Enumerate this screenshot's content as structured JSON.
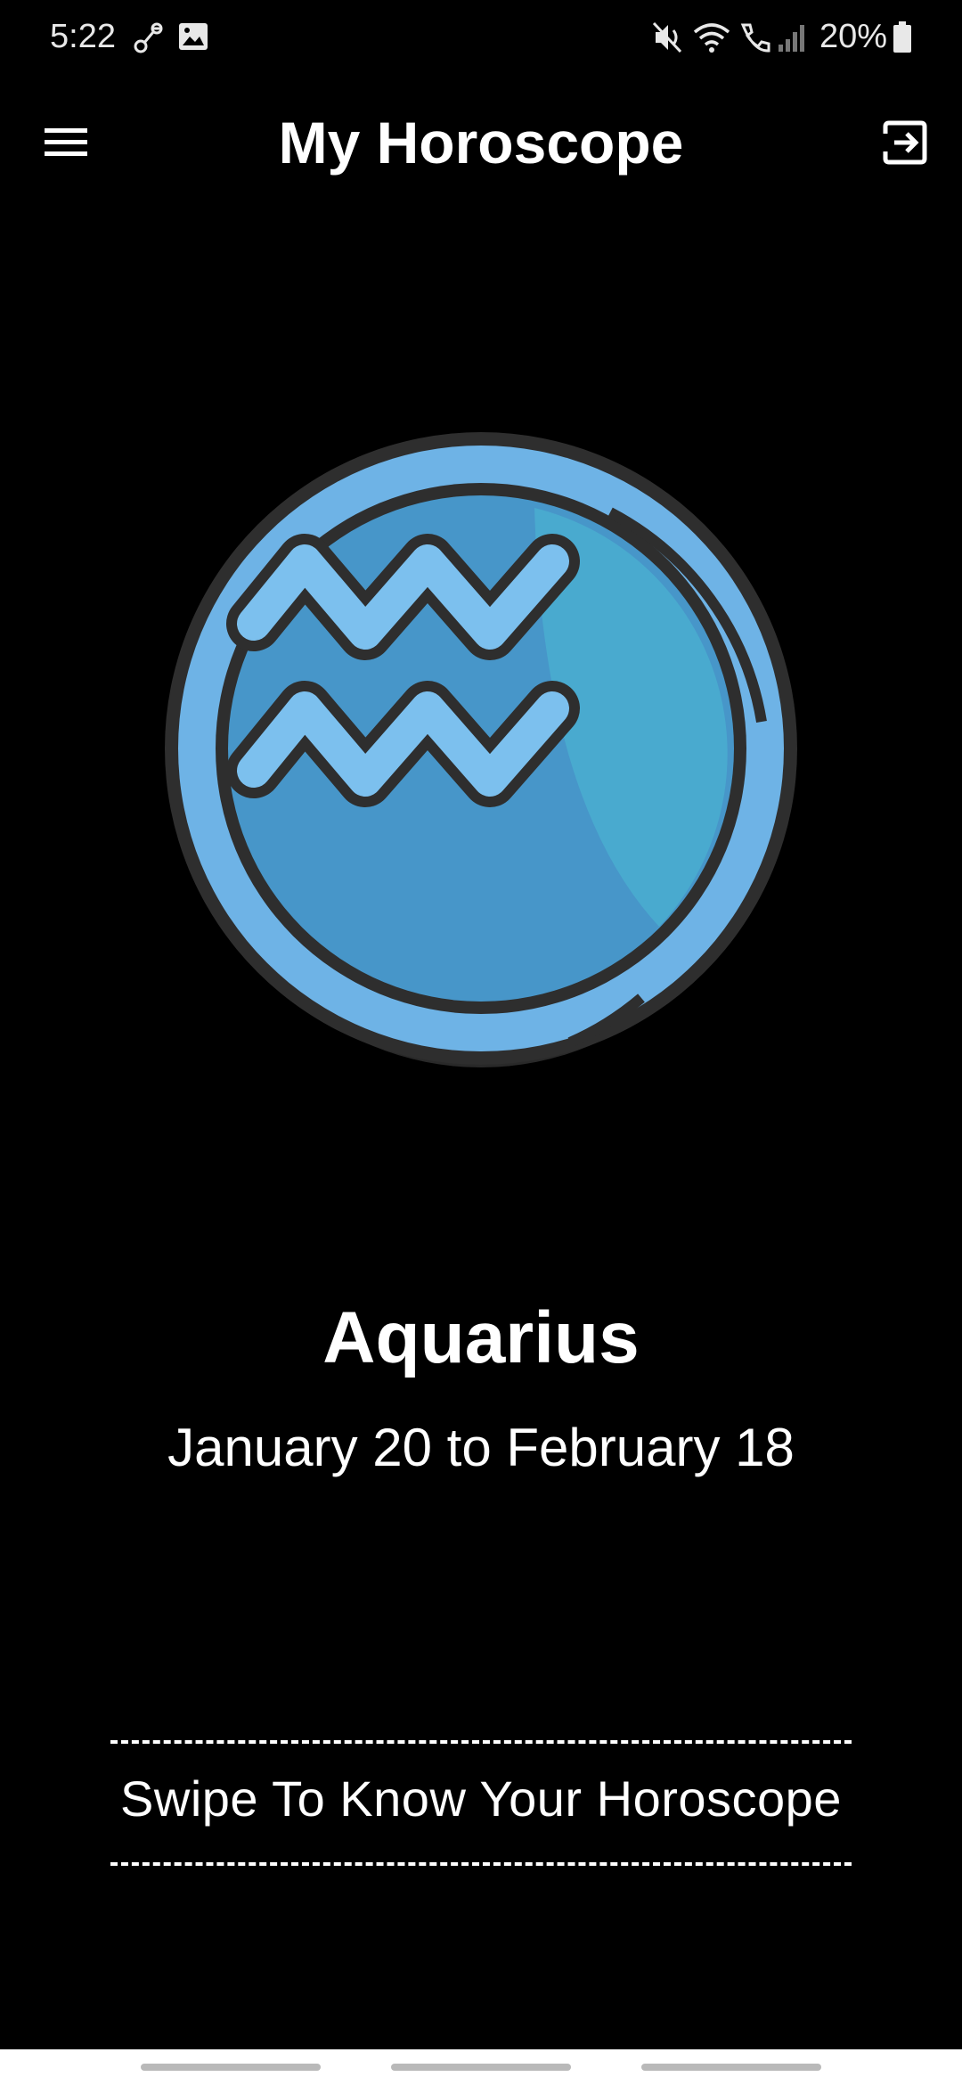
{
  "status_bar": {
    "time": "5:22",
    "battery": "20%",
    "icons": [
      "link-icon",
      "image-icon",
      "mute-icon",
      "wifi-icon",
      "wifi-call-icon",
      "signal-icon",
      "battery-icon"
    ]
  },
  "app_bar": {
    "title": "My Horoscope",
    "menu_icon": "hamburger-menu-icon",
    "logout_icon": "logout-icon"
  },
  "sign": {
    "name": "Aquarius",
    "dates": "January 20 to February 18",
    "emblem_icon": "aquarius-symbol-icon",
    "colors": {
      "outer_ring": "#6eb3e6",
      "inner_disc": "#4796c9",
      "highlight": "#49aacf",
      "wave": "#7cc0ee",
      "outline": "#2e2e2e",
      "teal_accent": "#2fae8f",
      "orange_accent": "#d9865a"
    }
  },
  "footer": {
    "swipe_hint": "Swipe To Know Your Horoscope"
  }
}
